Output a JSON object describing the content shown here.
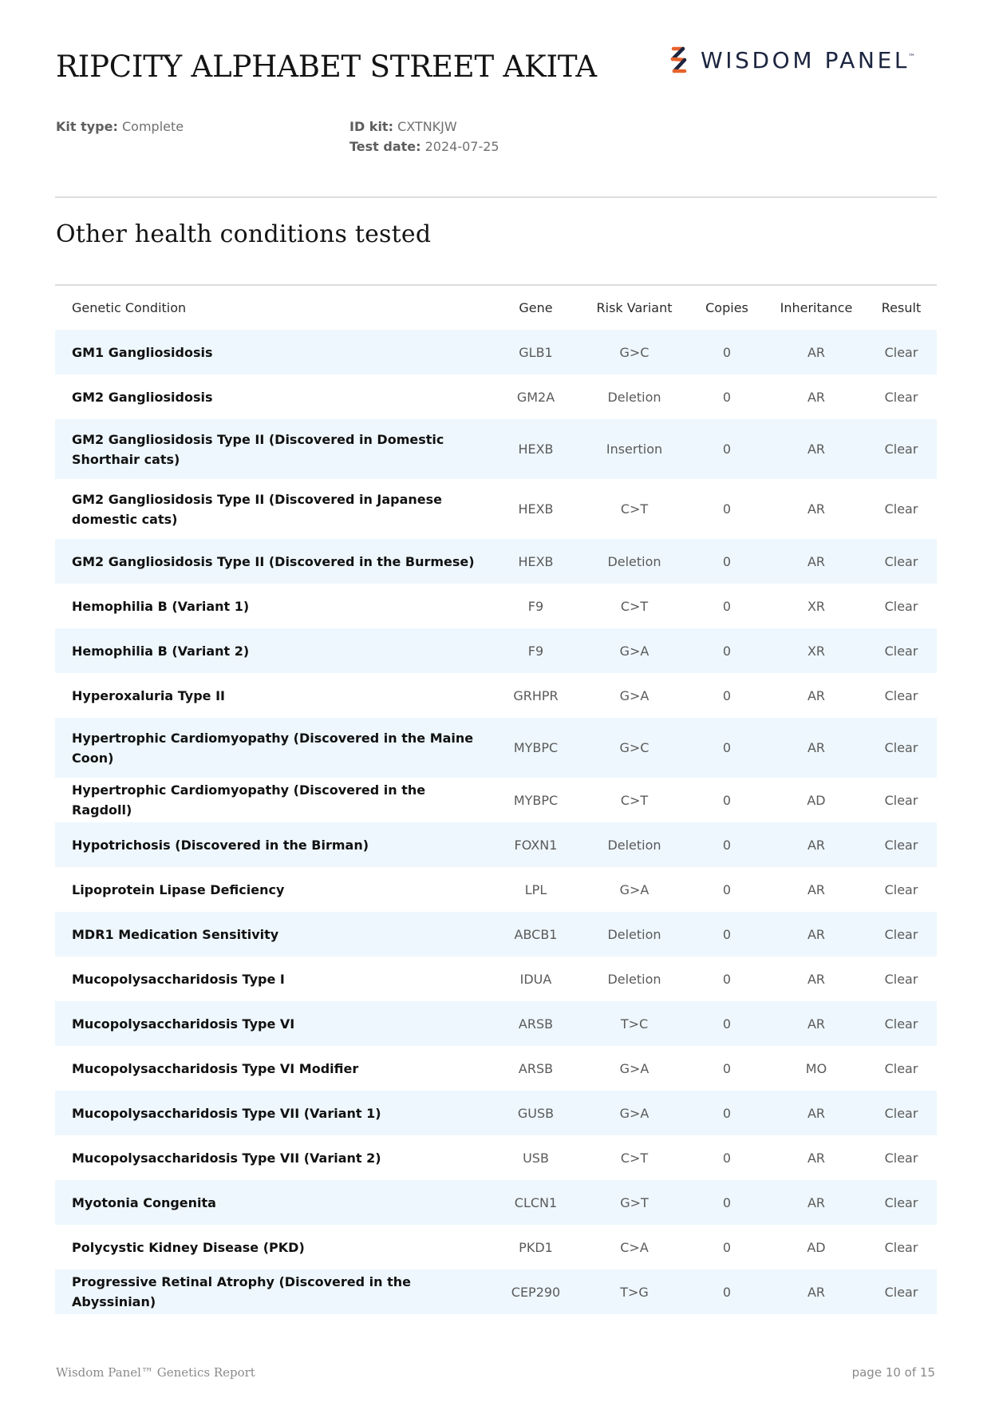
{
  "header": {
    "title": "RIPCITY ALPHABET STREET AKITA",
    "logo_text": "WISDOM PANEL",
    "logo_tm": "™",
    "kit_type_label": "Kit type:",
    "kit_type_value": "Complete",
    "id_kit_label": "ID kit:",
    "id_kit_value": "CXTNKJW",
    "test_date_label": "Test date:",
    "test_date_value": "2024-07-25"
  },
  "section": {
    "title": "Other health conditions tested"
  },
  "table": {
    "headers": [
      "Genetic Condition",
      "Gene",
      "Risk Variant",
      "Copies",
      "Inheritance",
      "Result"
    ],
    "rows": [
      {
        "condition": "GM1 Gangliosidosis",
        "gene": "GLB1",
        "variant": "G>C",
        "copies": "0",
        "inheritance": "AR",
        "result": "Clear",
        "tall": false
      },
      {
        "condition": "GM2 Gangliosidosis",
        "gene": "GM2A",
        "variant": "Deletion",
        "copies": "0",
        "inheritance": "AR",
        "result": "Clear",
        "tall": false
      },
      {
        "condition": "GM2 Gangliosidosis Type II (Discovered in Domestic Shorthair cats)",
        "gene": "HEXB",
        "variant": "Insertion",
        "copies": "0",
        "inheritance": "AR",
        "result": "Clear",
        "tall": true
      },
      {
        "condition": "GM2 Gangliosidosis Type II (Discovered in Japanese domestic cats)",
        "gene": "HEXB",
        "variant": "C>T",
        "copies": "0",
        "inheritance": "AR",
        "result": "Clear",
        "tall": true
      },
      {
        "condition": "GM2 Gangliosidosis Type II (Discovered in the Burmese)",
        "gene": "HEXB",
        "variant": "Deletion",
        "copies": "0",
        "inheritance": "AR",
        "result": "Clear",
        "tall": false
      },
      {
        "condition": "Hemophilia B (Variant 1)",
        "gene": "F9",
        "variant": "C>T",
        "copies": "0",
        "inheritance": "XR",
        "result": "Clear",
        "tall": false
      },
      {
        "condition": "Hemophilia B (Variant 2)",
        "gene": "F9",
        "variant": "G>A",
        "copies": "0",
        "inheritance": "XR",
        "result": "Clear",
        "tall": false
      },
      {
        "condition": "Hyperoxaluria Type II",
        "gene": "GRHPR",
        "variant": "G>A",
        "copies": "0",
        "inheritance": "AR",
        "result": "Clear",
        "tall": false
      },
      {
        "condition": "Hypertrophic Cardiomyopathy (Discovered in the Maine Coon)",
        "gene": "MYBPC",
        "variant": "G>C",
        "copies": "0",
        "inheritance": "AR",
        "result": "Clear",
        "tall": true
      },
      {
        "condition": "Hypertrophic Cardiomyopathy (Discovered in the Ragdoll)",
        "gene": "MYBPC",
        "variant": "C>T",
        "copies": "0",
        "inheritance": "AD",
        "result": "Clear",
        "tall": false
      },
      {
        "condition": "Hypotrichosis (Discovered in the Birman)",
        "gene": "FOXN1",
        "variant": "Deletion",
        "copies": "0",
        "inheritance": "AR",
        "result": "Clear",
        "tall": false
      },
      {
        "condition": "Lipoprotein Lipase Deficiency",
        "gene": "LPL",
        "variant": "G>A",
        "copies": "0",
        "inheritance": "AR",
        "result": "Clear",
        "tall": false
      },
      {
        "condition": "MDR1 Medication Sensitivity",
        "gene": "ABCB1",
        "variant": "Deletion",
        "copies": "0",
        "inheritance": "AR",
        "result": "Clear",
        "tall": false
      },
      {
        "condition": "Mucopolysaccharidosis Type I",
        "gene": "IDUA",
        "variant": "Deletion",
        "copies": "0",
        "inheritance": "AR",
        "result": "Clear",
        "tall": false
      },
      {
        "condition": "Mucopolysaccharidosis Type VI",
        "gene": "ARSB",
        "variant": "T>C",
        "copies": "0",
        "inheritance": "AR",
        "result": "Clear",
        "tall": false
      },
      {
        "condition": "Mucopolysaccharidosis Type VI Modifier",
        "gene": "ARSB",
        "variant": "G>A",
        "copies": "0",
        "inheritance": "MO",
        "result": "Clear",
        "tall": false
      },
      {
        "condition": "Mucopolysaccharidosis Type VII (Variant 1)",
        "gene": "GUSB",
        "variant": "G>A",
        "copies": "0",
        "inheritance": "AR",
        "result": "Clear",
        "tall": false
      },
      {
        "condition": "Mucopolysaccharidosis Type VII (Variant 2)",
        "gene": "USB",
        "variant": "C>T",
        "copies": "0",
        "inheritance": "AR",
        "result": "Clear",
        "tall": false
      },
      {
        "condition": "Myotonia Congenita",
        "gene": "CLCN1",
        "variant": "G>T",
        "copies": "0",
        "inheritance": "AR",
        "result": "Clear",
        "tall": false
      },
      {
        "condition": "Polycystic Kidney Disease (PKD)",
        "gene": "PKD1",
        "variant": "C>A",
        "copies": "0",
        "inheritance": "AD",
        "result": "Clear",
        "tall": false
      },
      {
        "condition": "Progressive Retinal Atrophy (Discovered in the Abyssinian)",
        "gene": "CEP290",
        "variant": "T>G",
        "copies": "0",
        "inheritance": "AR",
        "result": "Clear",
        "tall": false
      }
    ]
  },
  "footer": {
    "left": "Wisdom Panel™ Genetics Report",
    "right": "page 10 of 15"
  },
  "colors": {
    "row_stripe": "#eef7fd",
    "result_clear": "#2e7250",
    "logo_orange": "#e8622c",
    "logo_navy": "#1c2540"
  },
  "icons": {
    "logo_mark": "wisdom-panel-logo-mark-icon"
  }
}
